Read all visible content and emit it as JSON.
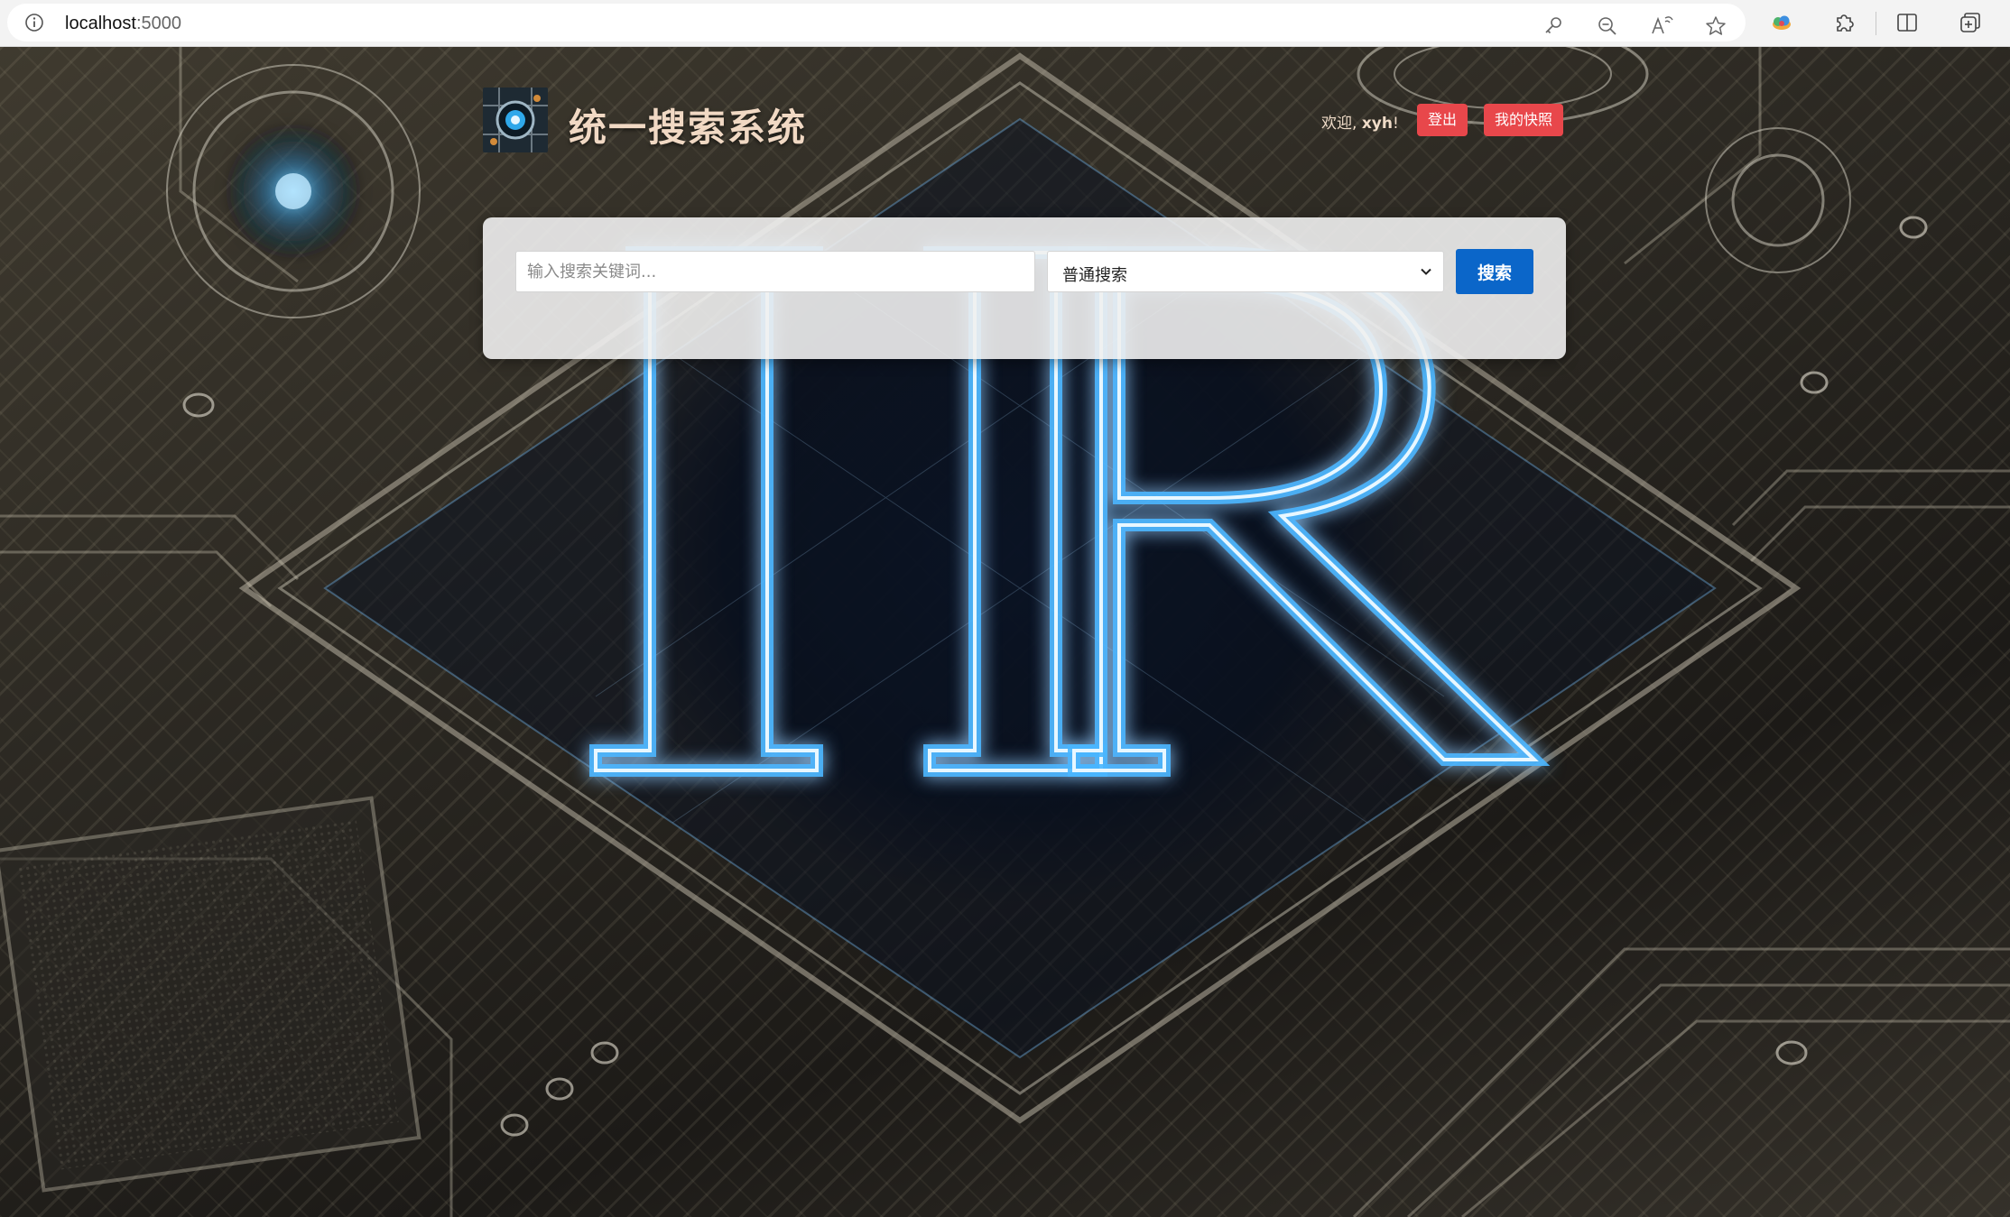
{
  "browser": {
    "url_host": "localhost",
    "url_port": ":5000",
    "icons": [
      "info-icon",
      "key-icon",
      "zoom-out-icon",
      "read-aloud-icon",
      "favorite-star-icon",
      "cloud-extension-icon",
      "extensions-puzzle-icon",
      "split-screen-icon",
      "collections-icon"
    ]
  },
  "header": {
    "title": "统一搜索系统",
    "logo_icon": "circuit-eye-logo",
    "welcome_prefix": "欢迎, ",
    "welcome_user": "xyh",
    "welcome_suffix": "!",
    "logout_label": "登出",
    "snapshot_label": "我的快照"
  },
  "search": {
    "placeholder": "输入搜索关键词...",
    "mode_selected": "普通搜索",
    "button_label": "搜索"
  },
  "colors": {
    "title": "#f1d9c4",
    "red_button": "#e8474b",
    "search_button": "#0b66c9",
    "glow_blue": "#49b6ff"
  },
  "background": {
    "glyph_text": "IR"
  }
}
